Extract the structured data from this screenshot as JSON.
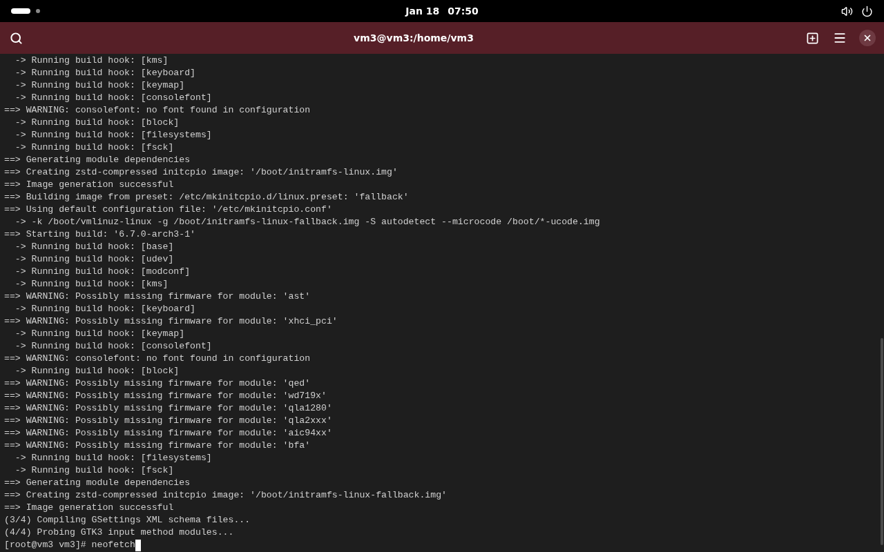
{
  "top_bar": {
    "date": "Jan 18",
    "time": "07:50"
  },
  "window": {
    "title": "vm3@vm3:/home/vm3"
  },
  "terminal": {
    "lines": [
      "  -> Running build hook: [kms]",
      "  -> Running build hook: [keyboard]",
      "  -> Running build hook: [keymap]",
      "  -> Running build hook: [consolefont]",
      "==> WARNING: consolefont: no font found in configuration",
      "  -> Running build hook: [block]",
      "  -> Running build hook: [filesystems]",
      "  -> Running build hook: [fsck]",
      "==> Generating module dependencies",
      "==> Creating zstd-compressed initcpio image: '/boot/initramfs-linux.img'",
      "==> Image generation successful",
      "==> Building image from preset: /etc/mkinitcpio.d/linux.preset: 'fallback'",
      "==> Using default configuration file: '/etc/mkinitcpio.conf'",
      "  -> -k /boot/vmlinuz-linux -g /boot/initramfs-linux-fallback.img -S autodetect --microcode /boot/*-ucode.img",
      "==> Starting build: '6.7.0-arch3-1'",
      "  -> Running build hook: [base]",
      "  -> Running build hook: [udev]",
      "  -> Running build hook: [modconf]",
      "  -> Running build hook: [kms]",
      "==> WARNING: Possibly missing firmware for module: 'ast'",
      "  -> Running build hook: [keyboard]",
      "==> WARNING: Possibly missing firmware for module: 'xhci_pci'",
      "  -> Running build hook: [keymap]",
      "  -> Running build hook: [consolefont]",
      "==> WARNING: consolefont: no font found in configuration",
      "  -> Running build hook: [block]",
      "==> WARNING: Possibly missing firmware for module: 'qed'",
      "==> WARNING: Possibly missing firmware for module: 'wd719x'",
      "==> WARNING: Possibly missing firmware for module: 'qla1280'",
      "==> WARNING: Possibly missing firmware for module: 'qla2xxx'",
      "==> WARNING: Possibly missing firmware for module: 'aic94xx'",
      "==> WARNING: Possibly missing firmware for module: 'bfa'",
      "  -> Running build hook: [filesystems]",
      "  -> Running build hook: [fsck]",
      "==> Generating module dependencies",
      "==> Creating zstd-compressed initcpio image: '/boot/initramfs-linux-fallback.img'",
      "==> Image generation successful",
      "(3/4) Compiling GSettings XML schema files...",
      "(4/4) Probing GTK3 input method modules..."
    ],
    "prompt": "[root@vm3 vm3]# neofetch"
  }
}
